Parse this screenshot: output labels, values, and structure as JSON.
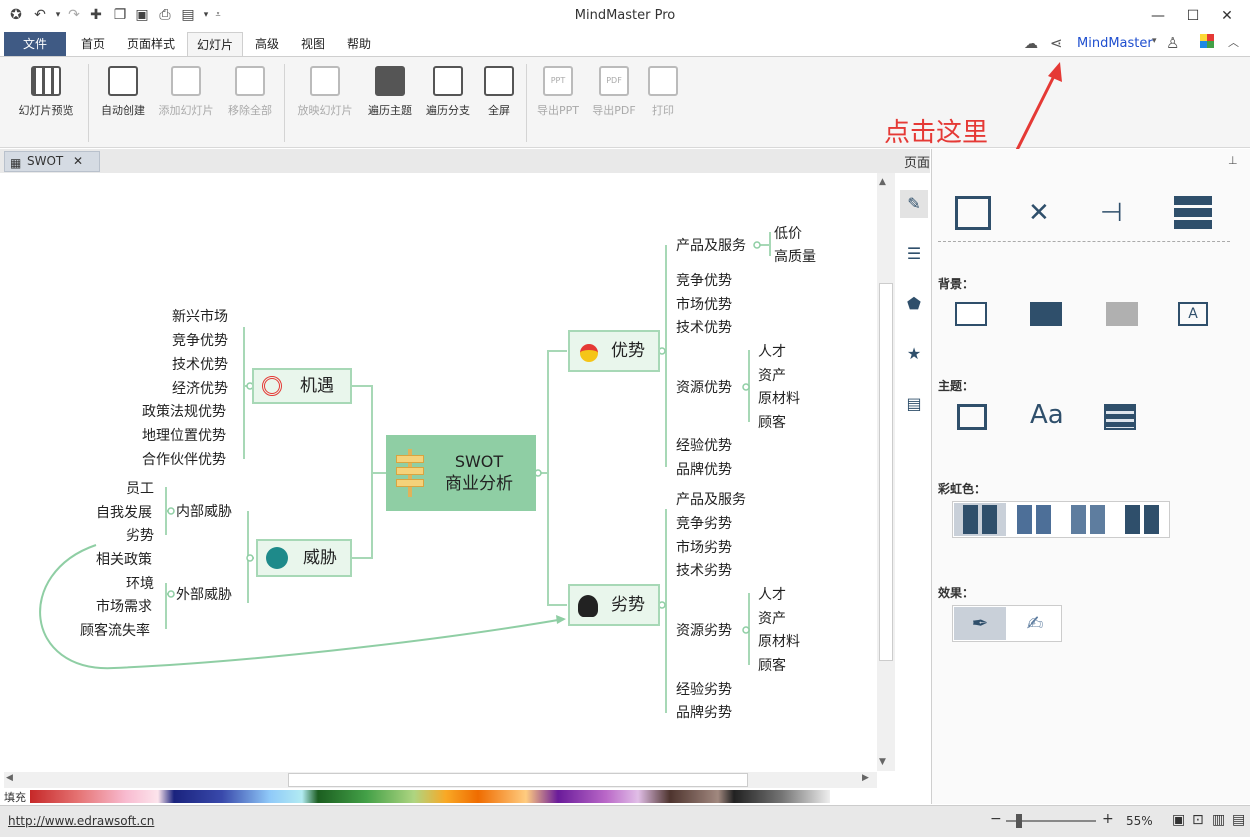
{
  "app": {
    "title": "MindMaster Pro"
  },
  "window": {
    "minimize": "—",
    "maximize": "☐",
    "close": "✕"
  },
  "menu": {
    "file": "文件",
    "items": [
      "首页",
      "页面样式",
      "幻灯片",
      "高级",
      "视图",
      "帮助"
    ],
    "active": "幻灯片",
    "brand": "MindMaster"
  },
  "ribbon": {
    "buttons": [
      "幻灯片预览",
      "自动创建",
      "添加幻灯片",
      "移除全部",
      "放映幻灯片",
      "遍历主题",
      "遍历分支",
      "全屏",
      "导出PPT",
      "导出PDF",
      "打印"
    ],
    "icon_ppt": "PPT",
    "icon_pdf": "PDF"
  },
  "annotation": {
    "text": "点击这里",
    "color": "#e53935"
  },
  "doc_tab": {
    "label": "SWOT"
  },
  "mindmap": {
    "center": {
      "line1": "SWOT",
      "line2": "商业分析"
    },
    "opportunity": {
      "label": "机遇",
      "items": [
        "新兴市场",
        "竞争优势",
        "技术优势",
        "经济优势",
        "政策法规优势",
        "地理位置优势",
        "合作伙伴优势"
      ]
    },
    "threat": {
      "label": "威胁",
      "internal": {
        "label": "内部威胁",
        "items": [
          "员工",
          "自我发展",
          "劣势"
        ]
      },
      "external": {
        "label": "外部威胁",
        "items": [
          "相关政策",
          "环境",
          "市场需求",
          "顾客流失率"
        ]
      }
    },
    "strength": {
      "label": "优势",
      "product": {
        "label": "产品及服务",
        "items": [
          "低价",
          "高质量"
        ]
      },
      "mid": [
        "竞争优势",
        "市场优势",
        "技术优势"
      ],
      "resource": {
        "label": "资源优势",
        "items": [
          "人才",
          "资产",
          "原材料",
          "顾客"
        ]
      },
      "tail": [
        "经验优势",
        "品牌优势"
      ]
    },
    "weakness": {
      "label": "劣势",
      "first": [
        "产品及服务",
        "竞争劣势",
        "市场劣势",
        "技术劣势"
      ],
      "resource": {
        "label": "资源劣势",
        "items": [
          "人才",
          "资产",
          "原材料",
          "顾客"
        ]
      },
      "tail": [
        "经验劣势",
        "品牌劣势"
      ]
    }
  },
  "panel": {
    "title": "页面",
    "background_label": "背景：",
    "theme_label": "主题：",
    "rainbow_label": "彩虹色：",
    "effect_label": "效果：",
    "theme_text_icon": "Aa"
  },
  "palette": {
    "fill_label": "填充"
  },
  "status": {
    "url": "http://www.edrawsoft.cn",
    "zoom": "55%",
    "minus": "−",
    "plus": "+"
  },
  "colors": {
    "accent": "#3f5a84",
    "node_fill": "#e9f6ec",
    "center_fill": "#8fcea4",
    "branch_line": "#a7d8b6"
  }
}
